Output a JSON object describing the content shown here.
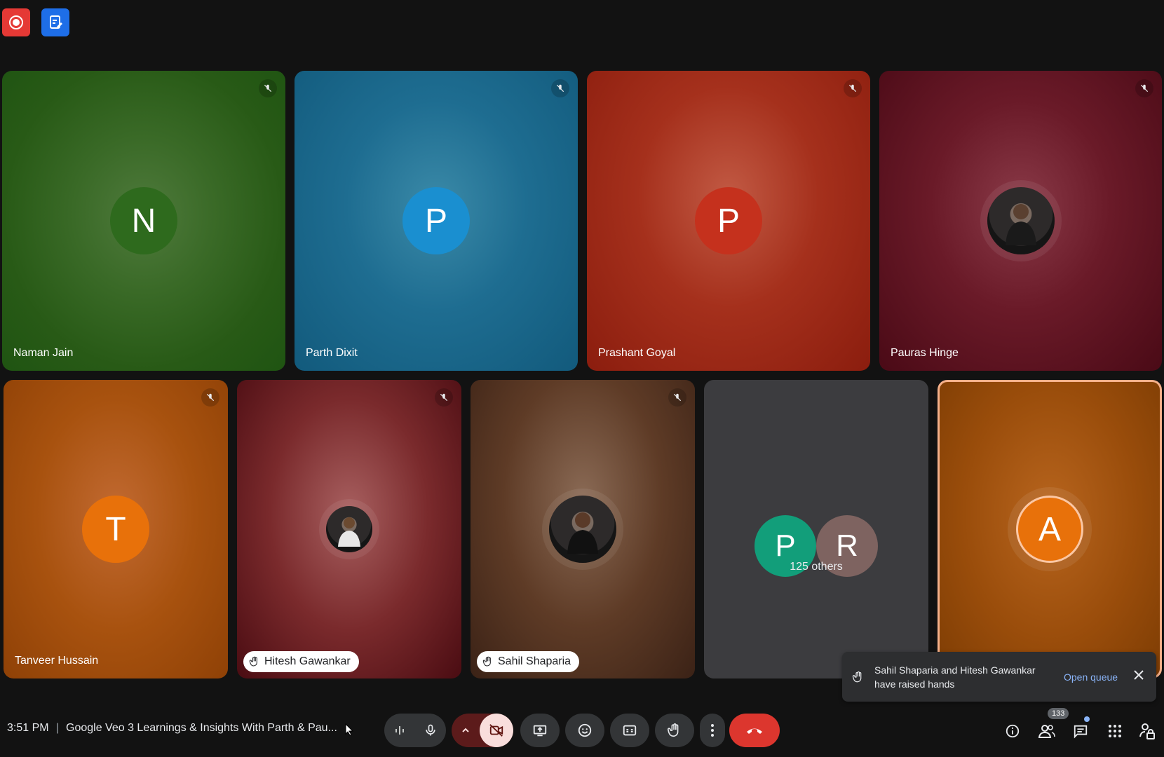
{
  "app": {
    "record_icon": "record-icon",
    "activities_icon": "activities-icon"
  },
  "tiles": [
    {
      "name": "Naman Jain",
      "initial": "N",
      "avatar_color": "#2e6a1d",
      "muted": true
    },
    {
      "name": "Parth Dixit",
      "initial": "P",
      "avatar_color": "#1a8fd0",
      "muted": true
    },
    {
      "name": "Prashant Goyal",
      "initial": "P",
      "avatar_color": "#c5311d",
      "muted": true
    },
    {
      "name": "Pauras Hinge",
      "initial": "",
      "avatar_color": "",
      "muted": true
    },
    {
      "name": "Tanveer Hussain",
      "initial": "T",
      "avatar_color": "#e8710a",
      "muted": true
    },
    {
      "name": "Hitesh Gawankar",
      "initial": "",
      "avatar_color": "",
      "muted": true,
      "hand_raised": true
    },
    {
      "name": "Sahil Shaparia",
      "initial": "",
      "avatar_color": "",
      "muted": true,
      "hand_raised": true
    }
  ],
  "others": {
    "avatars": [
      {
        "initial": "P",
        "color": "#129e7a"
      },
      {
        "initial": "R",
        "color": "#7e6360"
      }
    ],
    "label": "125 others"
  },
  "self_tile": {
    "initial": "A",
    "avatar_color": "#e8710a",
    "border_color": "#f5b08a"
  },
  "toast": {
    "message": "Sahil Shaparia and Hitesh Gawankar have raised hands",
    "action": "Open queue",
    "close_icon": "close-icon"
  },
  "bottom_bar": {
    "time": "3:51 PM",
    "separator": "|",
    "meeting_title": "Google Veo 3 Learnings & Insights With Parth & Pau...",
    "people_count": "133",
    "end_call_color": "#dc362e"
  }
}
